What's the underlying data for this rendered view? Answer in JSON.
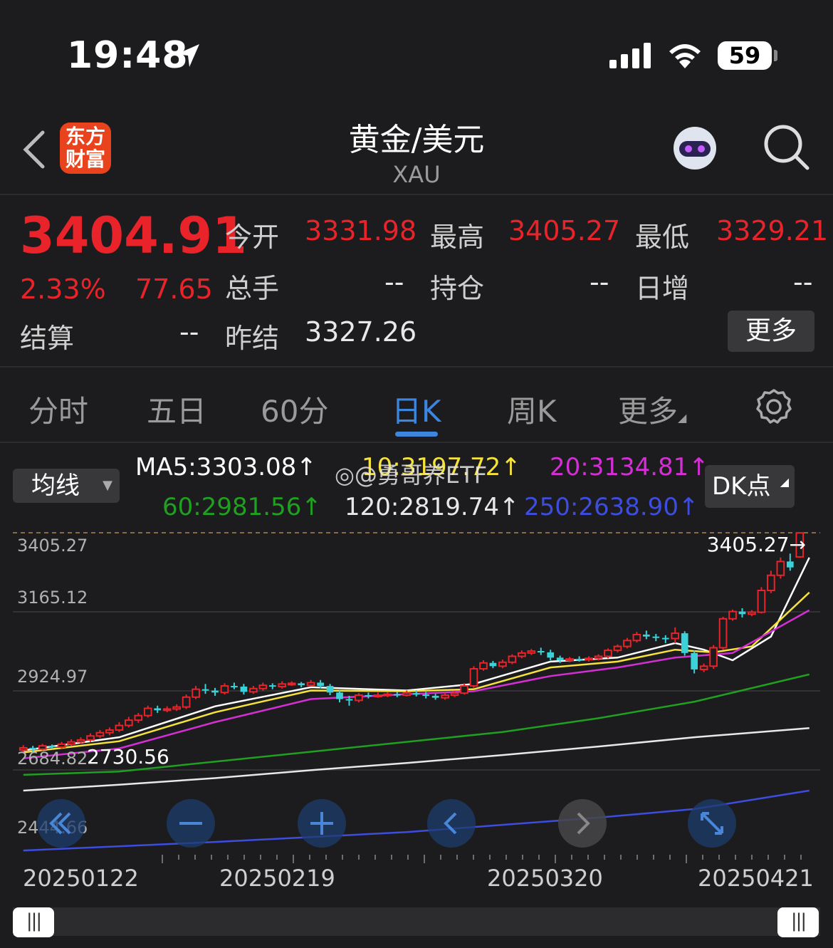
{
  "status": {
    "time": "19:48",
    "battery": "59"
  },
  "nav": {
    "logo_line1": "东方",
    "logo_line2": "财富",
    "title": "黄金/美元",
    "subtitle": "XAU"
  },
  "quote": {
    "price": "3404.91",
    "change_pct": "2.33%",
    "change": "77.65",
    "open_label": "今开",
    "open": "3331.98",
    "high_label": "最高",
    "high": "3405.27",
    "low_label": "最低",
    "low": "3329.21",
    "volume_label": "总手",
    "volume": "--",
    "oi_label": "持仓",
    "oi": "--",
    "daily_inc_label": "日增",
    "daily_inc": "--",
    "settle_label": "结算",
    "settle": "--",
    "prev_settle_label": "昨结",
    "prev_settle": "3327.26",
    "more_label": "更多"
  },
  "tabs": [
    {
      "label": "分时"
    },
    {
      "label": "五日"
    },
    {
      "label": "60分"
    },
    {
      "label": "日K"
    },
    {
      "label": "周K"
    },
    {
      "label": "更多"
    }
  ],
  "ma_panel": {
    "select_label": "均线",
    "ma5": "MA5:3303.08↑",
    "ma10": "10:3197.72↑",
    "ma20": "20:3134.81↑",
    "ma60": "60:2981.56↑",
    "ma120": "120:2819.74↑",
    "ma250": "250:2638.90↑",
    "dk_label": "DK点",
    "watermark": "@勇哥养ETF"
  },
  "colors": {
    "up": "#e8232a",
    "down": "#3ad1d8",
    "ma5": "#ffffff",
    "ma10": "#f5e23c",
    "ma20": "#d42fd4",
    "ma60": "#20a020",
    "ma120": "#e8e8e8",
    "ma250": "#3d4de0",
    "accent": "#3d86e0"
  },
  "chart_data": {
    "type": "candlestick",
    "price_axis_labels": [
      "3405.27",
      "3165.12",
      "2924.97",
      "2684.82",
      "2444.66"
    ],
    "ylim": [
      2444.66,
      3405.27
    ],
    "high_annotation": "3405.27→",
    "low_annotation": "2730.56",
    "date_labels": [
      "20250122",
      "20250219",
      "20250320",
      "20250421"
    ],
    "candles": [
      [
        2745,
        2752,
        2760,
        2738
      ],
      [
        2752,
        2748,
        2758,
        2740
      ],
      [
        2748,
        2758,
        2764,
        2744
      ],
      [
        2758,
        2754,
        2762,
        2748
      ],
      [
        2754,
        2763,
        2770,
        2750
      ],
      [
        2763,
        2770,
        2778,
        2758
      ],
      [
        2770,
        2776,
        2784,
        2764
      ],
      [
        2776,
        2788,
        2796,
        2770
      ],
      [
        2788,
        2798,
        2806,
        2782
      ],
      [
        2798,
        2806,
        2814,
        2790
      ],
      [
        2806,
        2820,
        2830,
        2800
      ],
      [
        2820,
        2836,
        2846,
        2814
      ],
      [
        2836,
        2850,
        2858,
        2828
      ],
      [
        2850,
        2872,
        2880,
        2844
      ],
      [
        2872,
        2866,
        2880,
        2858
      ],
      [
        2866,
        2870,
        2878,
        2860
      ],
      [
        2870,
        2876,
        2884,
        2864
      ],
      [
        2876,
        2906,
        2914,
        2870
      ],
      [
        2906,
        2930,
        2940,
        2900
      ],
      [
        2930,
        2926,
        2946,
        2916
      ],
      [
        2926,
        2920,
        2934,
        2910
      ],
      [
        2920,
        2940,
        2948,
        2914
      ],
      [
        2940,
        2938,
        2950,
        2930
      ],
      [
        2938,
        2922,
        2946,
        2914
      ],
      [
        2922,
        2932,
        2940,
        2916
      ],
      [
        2932,
        2942,
        2950,
        2926
      ],
      [
        2942,
        2938,
        2948,
        2930
      ],
      [
        2938,
        2946,
        2954,
        2932
      ],
      [
        2946,
        2948,
        2954,
        2940
      ],
      [
        2948,
        2942,
        2952,
        2936
      ],
      [
        2942,
        2950,
        2958,
        2938
      ],
      [
        2950,
        2940,
        2958,
        2932
      ],
      [
        2940,
        2920,
        2946,
        2912
      ],
      [
        2920,
        2900,
        2926,
        2890
      ],
      [
        2900,
        2896,
        2910,
        2880
      ],
      [
        2896,
        2912,
        2918,
        2890
      ],
      [
        2912,
        2910,
        2920,
        2902
      ],
      [
        2910,
        2912,
        2920,
        2904
      ],
      [
        2912,
        2915,
        2922,
        2906
      ],
      [
        2915,
        2912,
        2922,
        2906
      ],
      [
        2912,
        2918,
        2926,
        2908
      ],
      [
        2918,
        2914,
        2926,
        2908
      ],
      [
        2914,
        2910,
        2922,
        2902
      ],
      [
        2910,
        2904,
        2916,
        2898
      ],
      [
        2904,
        2912,
        2920,
        2898
      ],
      [
        2912,
        2918,
        2926,
        2906
      ],
      [
        2918,
        2940,
        2948,
        2914
      ],
      [
        2940,
        2992,
        3000,
        2934
      ],
      [
        2992,
        3010,
        3018,
        2986
      ],
      [
        3010,
        3000,
        3016,
        2994
      ],
      [
        3000,
        3012,
        3020,
        2994
      ],
      [
        3012,
        3030,
        3036,
        3006
      ],
      [
        3030,
        3040,
        3048,
        3024
      ],
      [
        3040,
        3046,
        3052,
        3034
      ],
      [
        3046,
        3042,
        3056,
        3034
      ],
      [
        3042,
        3026,
        3050,
        3018
      ],
      [
        3026,
        3018,
        3032,
        3010
      ],
      [
        3018,
        3022,
        3028,
        3012
      ],
      [
        3022,
        3020,
        3030,
        3014
      ],
      [
        3020,
        3024,
        3030,
        3014
      ],
      [
        3024,
        3030,
        3036,
        3018
      ],
      [
        3030,
        3048,
        3054,
        3024
      ],
      [
        3048,
        3060,
        3066,
        3042
      ],
      [
        3060,
        3078,
        3086,
        3054
      ],
      [
        3078,
        3096,
        3104,
        3072
      ],
      [
        3096,
        3090,
        3108,
        3082
      ],
      [
        3090,
        3086,
        3098,
        3076
      ],
      [
        3086,
        3084,
        3094,
        3070
      ],
      [
        3084,
        3100,
        3118,
        3070
      ],
      [
        3100,
        3040,
        3106,
        3032
      ],
      [
        3040,
        2990,
        3048,
        2978
      ],
      [
        2990,
        3000,
        3008,
        2982
      ],
      [
        3000,
        3056,
        3064,
        2992
      ],
      [
        3056,
        3144,
        3150,
        3050
      ],
      [
        3144,
        3166,
        3172,
        3138
      ],
      [
        3166,
        3158,
        3176,
        3148
      ],
      [
        3158,
        3164,
        3170,
        3152
      ],
      [
        3164,
        3230,
        3240,
        3160
      ],
      [
        3230,
        3276,
        3290,
        3222
      ],
      [
        3276,
        3318,
        3330,
        3266
      ],
      [
        3318,
        3300,
        3342,
        3290
      ],
      [
        3331.98,
        3404.91,
        3405.27,
        3329.21
      ]
    ],
    "moving_averages": {
      "ma5": [
        [
          0,
          2744
        ],
        [
          10,
          2784
        ],
        [
          20,
          2878
        ],
        [
          30,
          2936
        ],
        [
          40,
          2926
        ],
        [
          47,
          2946
        ],
        [
          55,
          3014
        ],
        [
          62,
          3026
        ],
        [
          68,
          3070
        ],
        [
          71,
          3050
        ],
        [
          74,
          3018
        ],
        [
          78,
          3090
        ],
        [
          82,
          3330
        ]
      ],
      "ma10": [
        [
          0,
          2738
        ],
        [
          10,
          2772
        ],
        [
          20,
          2860
        ],
        [
          30,
          2926
        ],
        [
          40,
          2924
        ],
        [
          47,
          2930
        ],
        [
          55,
          2996
        ],
        [
          62,
          3014
        ],
        [
          68,
          3050
        ],
        [
          72,
          3042
        ],
        [
          76,
          3060
        ],
        [
          82,
          3224
        ]
      ],
      "ma20": [
        [
          0,
          2720
        ],
        [
          10,
          2750
        ],
        [
          20,
          2830
        ],
        [
          30,
          2900
        ],
        [
          40,
          2915
        ],
        [
          47,
          2924
        ],
        [
          55,
          2970
        ],
        [
          62,
          2996
        ],
        [
          68,
          3026
        ],
        [
          74,
          3040
        ],
        [
          82,
          3170
        ]
      ],
      "ma60": [
        [
          0,
          2670
        ],
        [
          10,
          2680
        ],
        [
          20,
          2710
        ],
        [
          30,
          2740
        ],
        [
          40,
          2770
        ],
        [
          50,
          2800
        ],
        [
          60,
          2842
        ],
        [
          70,
          2892
        ],
        [
          82,
          2975
        ]
      ],
      "ma120": [
        [
          0,
          2622
        ],
        [
          10,
          2640
        ],
        [
          20,
          2660
        ],
        [
          30,
          2684
        ],
        [
          40,
          2706
        ],
        [
          50,
          2730
        ],
        [
          60,
          2756
        ],
        [
          70,
          2784
        ],
        [
          82,
          2812
        ]
      ],
      "ma250": [
        [
          0,
          2440
        ],
        [
          20,
          2466
        ],
        [
          40,
          2496
        ],
        [
          60,
          2540
        ],
        [
          70,
          2566
        ],
        [
          82,
          2622
        ]
      ]
    }
  }
}
